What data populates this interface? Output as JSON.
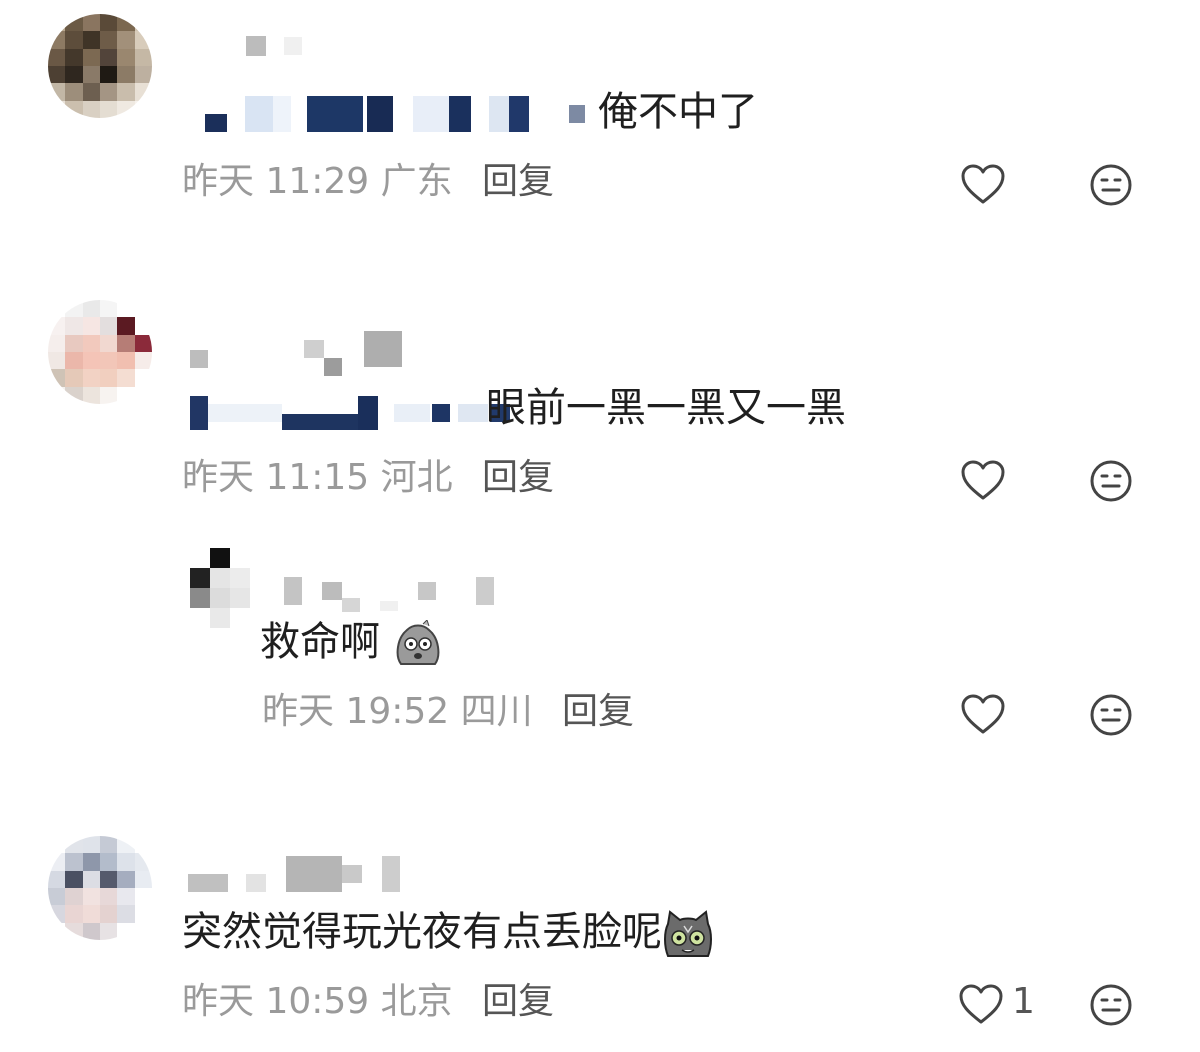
{
  "comments": [
    {
      "text": "俺不中了",
      "time": "昨天 11:29",
      "location": "广东",
      "reply_label": "回复",
      "like_count": ""
    },
    {
      "text": "眼前一黑一黑又一黑",
      "time": "昨天 11:15",
      "location": "河北",
      "reply_label": "回复",
      "like_count": ""
    },
    {
      "text": "救命啊",
      "time": "昨天 19:52",
      "location": "四川",
      "reply_label": "回复",
      "like_count": "",
      "emoji": "sweating-face-sticker"
    },
    {
      "text": "突然觉得玩光夜有点丢脸呢",
      "time": "昨天 10:59",
      "location": "北京",
      "reply_label": "回复",
      "like_count": "1",
      "emoji": "cat-face-sticker"
    }
  ],
  "icons": {
    "like": "heart-outline-icon",
    "dislike": "neutral-face-icon"
  },
  "colors": {
    "meta_text": "#9a9a9a",
    "reply_text": "#555555",
    "body_text": "#1f1f1f",
    "icon_stroke": "#444444"
  }
}
